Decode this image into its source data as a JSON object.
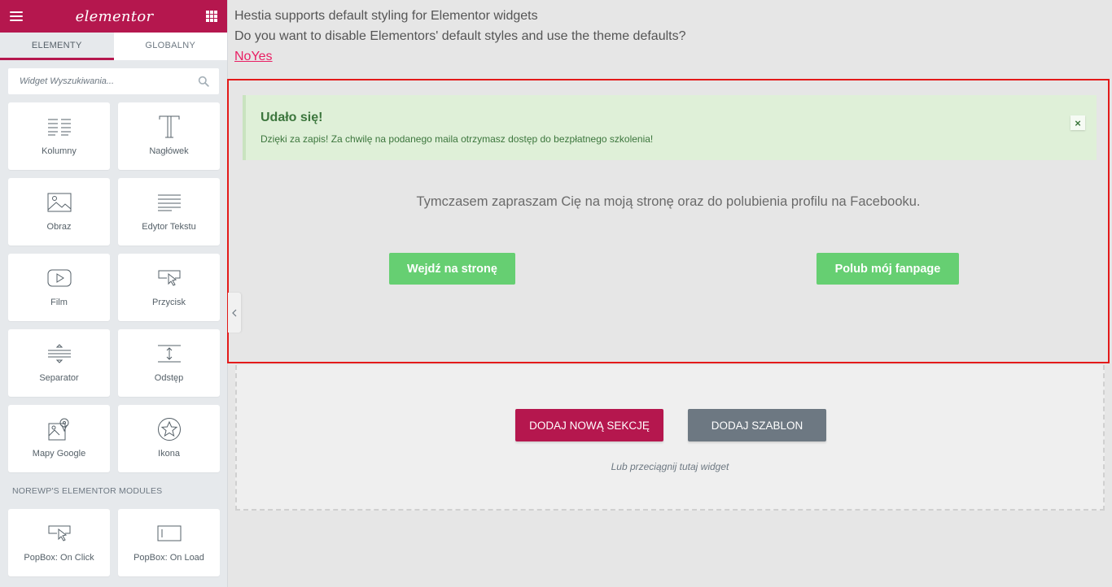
{
  "sidebar": {
    "logo": "elementor",
    "tabs": [
      {
        "label": "ELEMENTY",
        "active": true
      },
      {
        "label": "GLOBALNY",
        "active": false
      }
    ],
    "search": {
      "placeholder": "Widget Wyszukiwania..."
    },
    "widgets": [
      {
        "label": "Kolumny",
        "icon": "columns-icon"
      },
      {
        "label": "Nagłówek",
        "icon": "heading-icon"
      },
      {
        "label": "Obraz",
        "icon": "image-icon"
      },
      {
        "label": "Edytor Tekstu",
        "icon": "text-editor-icon"
      },
      {
        "label": "Film",
        "icon": "video-icon"
      },
      {
        "label": "Przycisk",
        "icon": "button-icon"
      },
      {
        "label": "Separator",
        "icon": "divider-icon"
      },
      {
        "label": "Odstęp",
        "icon": "spacer-icon"
      },
      {
        "label": "Mapy Google",
        "icon": "map-icon"
      },
      {
        "label": "Ikona",
        "icon": "star-icon"
      }
    ],
    "category": "NOREWP'S ELEMENTOR MODULES",
    "category_widgets": [
      {
        "label": "PopBox: On Click",
        "icon": "popbox-click-icon"
      },
      {
        "label": "PopBox: On Load",
        "icon": "popbox-load-icon"
      }
    ]
  },
  "preview": {
    "notice_line1": "Hestia supports default styling for Elementor widgets",
    "notice_line2": "Do you want to disable Elementors' default styles and use the theme defaults?",
    "notice_no": "No",
    "notice_yes": "Yes",
    "success_title": "Udało się!",
    "success_message": "Dzięki za zapis! Za chwilę na podanego maila otrzymasz dostęp do bezpłatnego szkolenia!",
    "success_close": "×",
    "invite_text": "Tymczasem zapraszam Cię na moją stronę oraz do polubienia profilu na Facebooku.",
    "cta_site": "Wejdź na stronę",
    "cta_fanpage": "Polub mój fanpage",
    "add_section": "DODAJ NOWĄ SEKCJĘ",
    "add_template": "DODAJ SZABLON",
    "drop_hint": "Lub przeciągnij tutaj widget"
  },
  "colors": {
    "brand": "#b5174e",
    "success_bg": "#dff0d8",
    "success_text": "#3c763d",
    "cta_green": "#66cf72",
    "highlight_border": "#e31a1a",
    "link_pink": "#e91e63",
    "template_gray": "#6d7882"
  }
}
